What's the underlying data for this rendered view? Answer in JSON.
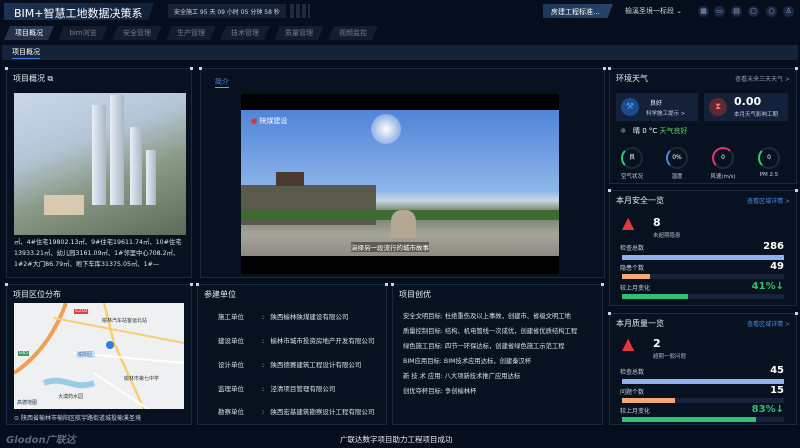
{
  "header": {
    "title": "BIM+智慧工地数据决策系统",
    "timer": "安全施工 95 天 09 小时 05 分钟 58 秒",
    "project_type": "房建工程标准...",
    "section": "榆溪圣境一标段",
    "icons": [
      "apps-icon",
      "screen-icon",
      "document-icon",
      "message-icon",
      "settings-icon",
      "user-icon"
    ]
  },
  "tabs": [
    {
      "label": "项目概况",
      "active": true
    },
    {
      "label": "bim浏览"
    },
    {
      "label": "安全管理"
    },
    {
      "label": "生产管理"
    },
    {
      "label": "技术管理"
    },
    {
      "label": "质量管理"
    },
    {
      "label": "视频监控"
    }
  ],
  "subtab": "项目概况",
  "overview": {
    "title": "项目概况",
    "text": "㎡、4#住宅19802.13㎡、9#住宅19611.74㎡、10#住宅13933.21㎡、幼儿园3161.09㎡、1#邻里中心708.2㎡、1#2#大门86.79㎡、地下车库31375.05㎡、1#—"
  },
  "location": {
    "title": "项目区位分布",
    "address": "陕西省榆林市榆阳区航宇路街道城投榆溪圣境",
    "map_labels": [
      "榆林汽车站客运北站",
      "榆阳区",
      "榆林市第七中学",
      "大漠药水园",
      "G210",
      "G65",
      "高德地图"
    ]
  },
  "intro": {
    "tab": "简介",
    "video_logo": "陕煤建设",
    "video_subtitle": "演绎另一段流行的城市故事"
  },
  "units": {
    "title": "参建单位",
    "rows": [
      {
        "k": "施工单位",
        "v": "陕西榆林陕煤建设有限公司"
      },
      {
        "k": "建设单位",
        "v": "榆林市城市投资房地产开发有限公司"
      },
      {
        "k": "设计单位",
        "v": "陕西德赛建筑工程设计有限公司"
      },
      {
        "k": "监理单位",
        "v": "泾清项目管理有限公司"
      },
      {
        "k": "勘察单位",
        "v": "陕西宏基建筑勘察设计工程有限公司"
      }
    ]
  },
  "excellence": {
    "title": "项目创优",
    "goals": [
      "安全文明目标: 杜绝重伤及以上事故，创建市、省级文明工地",
      "质量控制目标: 结构、机电管线一次成优，创建省优质结构工程",
      "绿色施工目标: 四节一环保达标，创建省绿色施工示范工程",
      "BIM应用目标: BIM技术应用达标，创建秦汉杯",
      "新 技 术 应用: 八大项新技术推广应用达标",
      "创优夺杯目标: 争创榆林杯"
    ]
  },
  "weather": {
    "title": "环境天气",
    "link": "查看未来三天天气 >",
    "status": "良好",
    "tip": "科学施工提示 >",
    "delay": "0.00",
    "delay_label": "本月天气影响工期",
    "condition": "晴",
    "temp": "0 °C",
    "good": "天气良好",
    "gauges": [
      {
        "value": "良",
        "label": "空气状况",
        "color": "#2ecc71"
      },
      {
        "value": "0%",
        "label": "湿度",
        "color": "#3a8ef0"
      },
      {
        "value": "0",
        "label": "风速(m/s)",
        "color": "#e8336f"
      },
      {
        "value": "0",
        "label": "PM 2.5",
        "color": "#2ecc71"
      }
    ]
  },
  "safety": {
    "title": "本月安全一览",
    "link": "查看区域详情 >",
    "count": "8",
    "count_label": "未超期隐患",
    "total_label": "检查总数",
    "total": "286",
    "issues_label": "隐患个数",
    "issues": "49",
    "change_label": "较上月变化",
    "change": "41%↓",
    "total_pct": 100,
    "issues_pct": 17,
    "change_pct": 41
  },
  "quality": {
    "title": "本月质量一览",
    "link": "查看区域详情 >",
    "count": "2",
    "count_label": "超期一般问题",
    "total_label": "检查总数",
    "total": "45",
    "issues_label": "问题个数",
    "issues": "15",
    "change_label": "较上月变化",
    "change": "83%↓",
    "total_pct": 100,
    "issues_pct": 33,
    "change_pct": 83
  },
  "footer": {
    "logo": "Glodon广联达",
    "slogan": "广联达数字项目助力工程项目成功"
  },
  "colors": {
    "accent": "#3d7be0",
    "bar_total": "#8fb0f0",
    "bar_issue": "#f4a877",
    "bar_change": "#2ec270",
    "good": "#2ecc71"
  }
}
